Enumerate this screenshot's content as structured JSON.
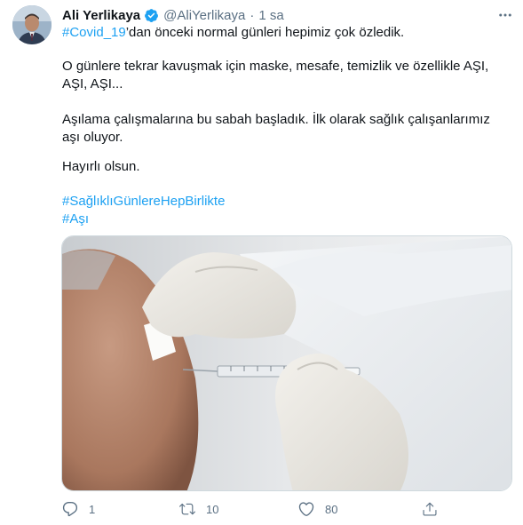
{
  "tweet": {
    "author_name": "Ali Yerlikaya",
    "author_handle": "@AliYerlikaya",
    "separator": "·",
    "time": "1 sa",
    "text": {
      "p1_hashtag": "#Covid_19",
      "p1_rest": "’dan önceki normal günleri hepimiz çok özledik.",
      "p2": "O günlere tekrar kavuşmak için maske, mesafe, temizlik ve özellikle AŞI, AŞI, AŞI...",
      "p3": "Aşılama çalışmalarına bu sabah başladık. İlk olarak sağlık çalışanlarımız aşı oluyor.",
      "p4": "Hayırlı olsun.",
      "hashtag1": "#SağlıklıGünlereHepBirlikte",
      "hashtag2": "#Aşı"
    },
    "actions": {
      "reply_count": "1",
      "retweet_count": "10",
      "like_count": "80"
    },
    "colors": {
      "link": "#1da1f2",
      "secondary": "#5b7083",
      "text": "#0f1419"
    },
    "icons": [
      "verified-badge-icon",
      "more-icon",
      "reply-icon",
      "retweet-icon",
      "like-icon",
      "share-icon"
    ]
  }
}
